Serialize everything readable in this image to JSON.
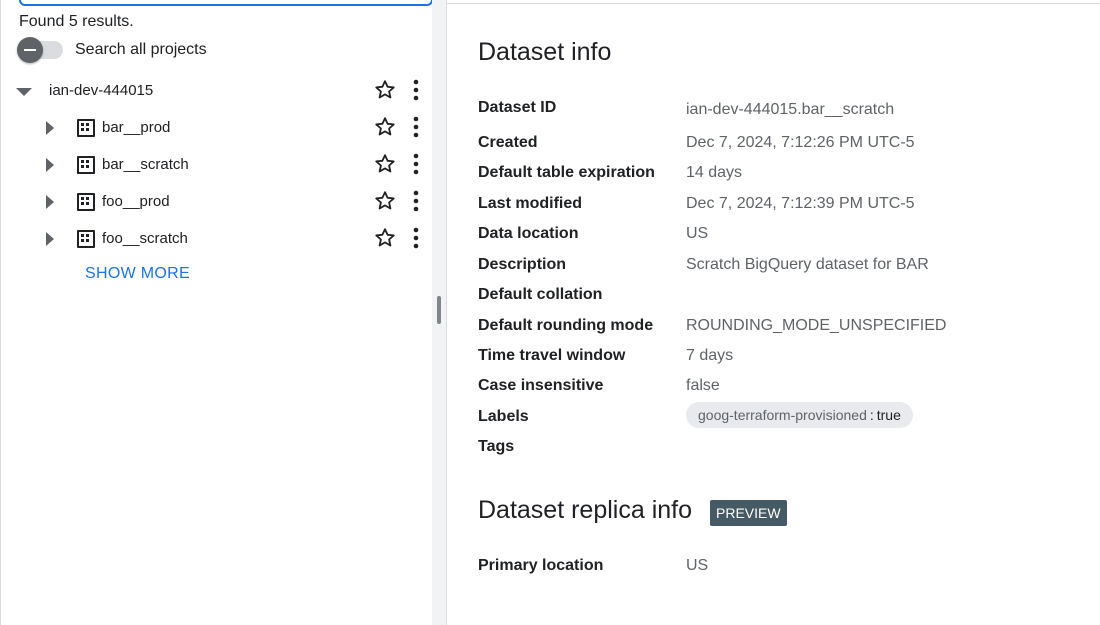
{
  "explorer": {
    "results_text": "Found 5 results.",
    "search_all_projects_label": "Search all projects",
    "project": {
      "name": "ian-dev-444015"
    },
    "datasets": [
      {
        "name": "bar__prod"
      },
      {
        "name": "bar__scratch"
      },
      {
        "name": "foo__prod"
      },
      {
        "name": "foo__scratch"
      }
    ],
    "show_more_label": "SHOW MORE"
  },
  "dataset_info": {
    "title": "Dataset info",
    "rows": [
      {
        "key": "Dataset ID",
        "value": "ian-dev-444015.bar__scratch"
      },
      {
        "key": "Created",
        "value": "Dec 7, 2024, 7:12:26 PM UTC-5"
      },
      {
        "key": "Default table expiration",
        "value": "14 days"
      },
      {
        "key": "Last modified",
        "value": "Dec 7, 2024, 7:12:39 PM UTC-5"
      },
      {
        "key": "Data location",
        "value": "US"
      },
      {
        "key": "Description",
        "value": "Scratch BigQuery dataset for BAR"
      },
      {
        "key": "Default collation",
        "value": ""
      },
      {
        "key": "Default rounding mode",
        "value": "ROUNDING_MODE_UNSPECIFIED"
      },
      {
        "key": "Time travel window",
        "value": "7 days"
      },
      {
        "key": "Case insensitive",
        "value": "false"
      }
    ],
    "labels_key": "Labels",
    "label_chip": {
      "key": "goog-terraform-provisioned",
      "separator": ":",
      "value": "true"
    },
    "tags_key": "Tags"
  },
  "replica_info": {
    "title": "Dataset replica info",
    "badge": "PREVIEW",
    "rows": [
      {
        "key": "Primary location",
        "value": "US"
      }
    ]
  },
  "colors": {
    "accent": "#1a73e8",
    "badge_bg": "#455a64",
    "chip_bg": "#e8eaed"
  },
  "icons": {
    "expand": "caret-down-icon",
    "collapse": "caret-right-icon",
    "dataset": "dataset-grid-icon",
    "favorite": "star-outline-icon",
    "more": "more-vert-icon"
  }
}
